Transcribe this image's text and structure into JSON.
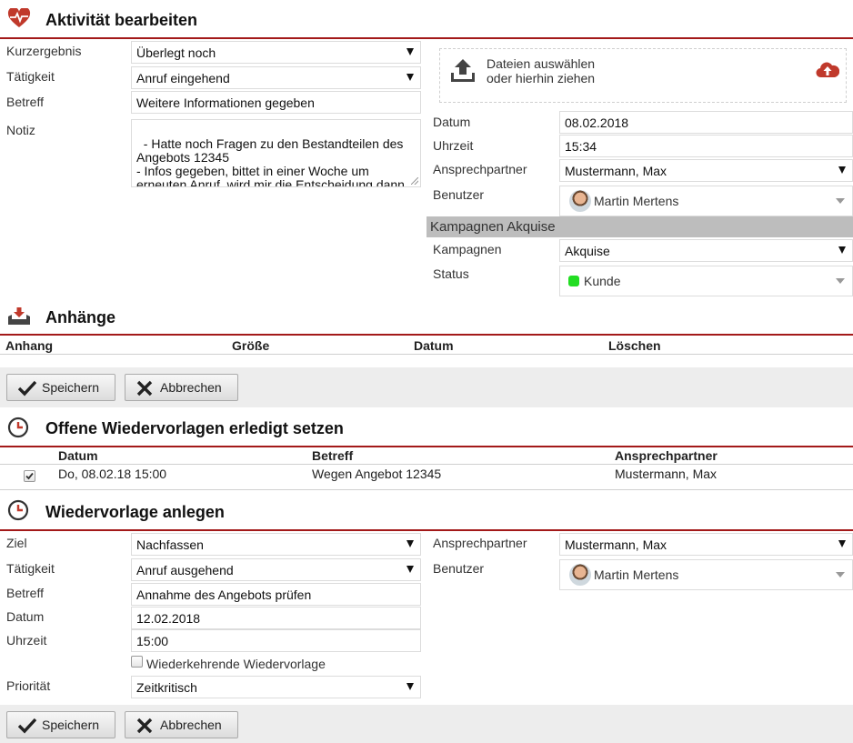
{
  "colors": {
    "accent": "#a31919",
    "status_dot": "#22dd22",
    "band": "#bdbdbd",
    "bar": "#ededed"
  },
  "activity": {
    "title": "Aktivität bearbeiten",
    "icon": "heart-pulse-icon",
    "left": {
      "kurzergebnis": {
        "label": "Kurzergebnis",
        "value": "Überlegt noch"
      },
      "taetigkeit": {
        "label": "Tätigkeit",
        "value": "Anruf eingehend"
      },
      "betreff": {
        "label": "Betreff",
        "value": "Weitere Informationen gegeben"
      },
      "notiz": {
        "label": "Notiz",
        "value": "- Hatte noch Fragen zu den Bestandteilen des Angebots 12345\n- Infos gegeben, bittet in einer Woche um erneuten Anruf, wird mir die Entscheidung dann mitteilen"
      }
    },
    "upload": {
      "line1": "Dateien auswählen",
      "line2": "oder hierhin ziehen"
    },
    "right": {
      "datum": {
        "label": "Datum",
        "value": "08.02.2018"
      },
      "uhrzeit": {
        "label": "Uhrzeit",
        "value": "15:34"
      },
      "ansprechpartner": {
        "label": "Ansprechpartner",
        "value": "Mustermann, Max"
      },
      "benutzer": {
        "label": "Benutzer",
        "value": "Martin Mertens"
      }
    },
    "campaign": {
      "band": "Kampagnen Akquise",
      "kampagnen": {
        "label": "Kampagnen",
        "value": "Akquise"
      },
      "status": {
        "label": "Status",
        "value": "Kunde"
      }
    }
  },
  "attachments": {
    "title": "Anhänge",
    "icon": "download-tray-icon",
    "columns": [
      "Anhang",
      "Größe",
      "Datum",
      "Löschen"
    ]
  },
  "buttons": {
    "save": "Speichern",
    "cancel": "Abbrechen"
  },
  "open_followups": {
    "title": "Offene Wiedervorlagen erledigt setzen",
    "icon": "clock-icon",
    "columns": [
      "Datum",
      "Betreff",
      "Ansprechpartner"
    ],
    "rows": [
      {
        "checked": true,
        "datum": "Do, 08.02.18 15:00",
        "betreff": "Wegen Angebot 12345",
        "ansprechpartner": "Mustermann, Max"
      }
    ]
  },
  "new_followup": {
    "title": "Wiedervorlage anlegen",
    "icon": "clock-icon",
    "ziel": {
      "label": "Ziel",
      "value": "Nachfassen"
    },
    "taetigkeit": {
      "label": "Tätigkeit",
      "value": "Anruf ausgehend"
    },
    "betreff": {
      "label": "Betreff",
      "value": "Annahme des Angebots prüfen"
    },
    "datum": {
      "label": "Datum",
      "value": "12.02.2018"
    },
    "uhrzeit": {
      "label": "Uhrzeit",
      "value": "15:00"
    },
    "recurring": {
      "label": "Wiederkehrende Wiedervorlage",
      "checked": false
    },
    "prioritaet": {
      "label": "Priorität",
      "value": "Zeitkritisch"
    },
    "ansprechpartner": {
      "label": "Ansprechpartner",
      "value": "Mustermann, Max"
    },
    "benutzer": {
      "label": "Benutzer",
      "value": "Martin Mertens"
    }
  }
}
